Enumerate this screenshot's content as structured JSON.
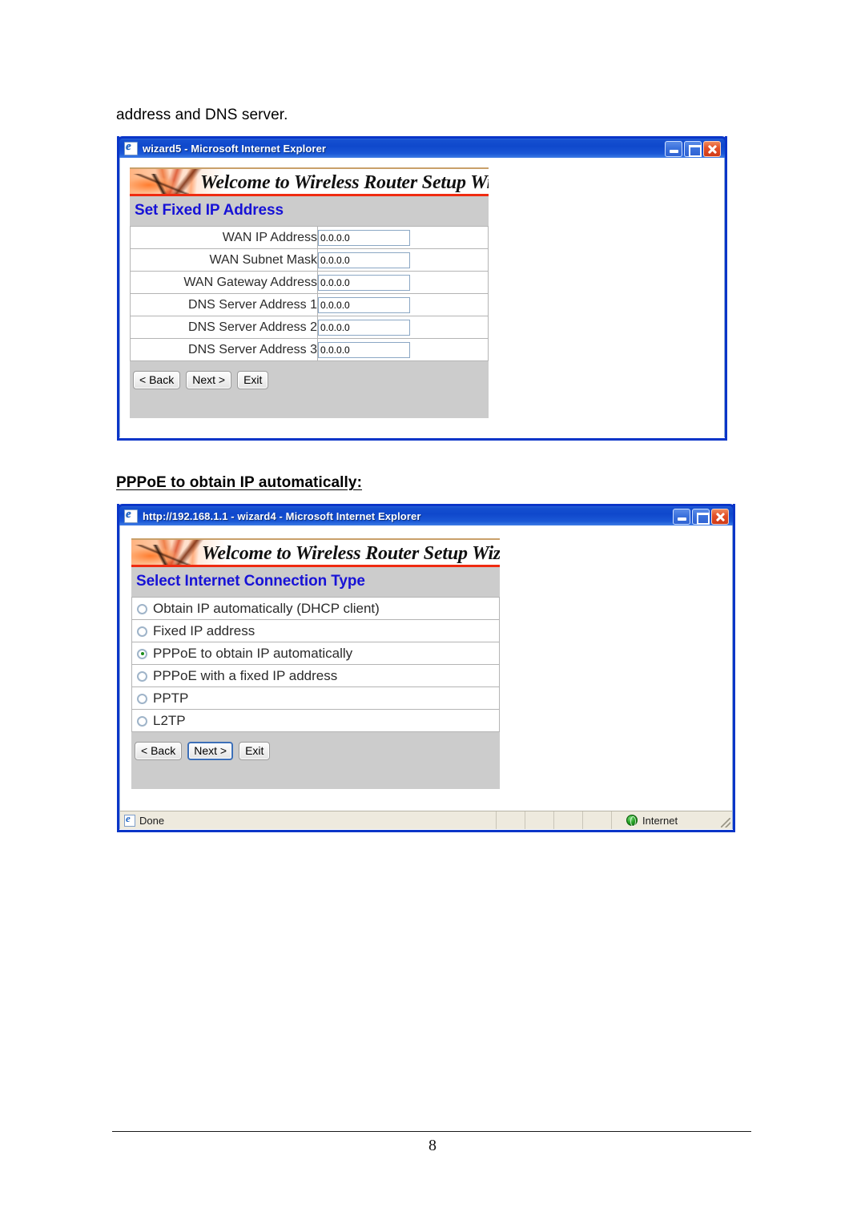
{
  "document": {
    "intro_text": "address and DNS server.",
    "section_heading": "PPPoE to obtain IP automatically:",
    "page_number": "8"
  },
  "window_fixed_ip": {
    "title": "wizard5 - Microsoft Internet Explorer",
    "doc_icon": "ie-document-icon",
    "controls": {
      "minimize": "minimize-icon",
      "maximize": "maximize-icon",
      "close": "close-icon"
    },
    "banner_title": "Welcome to Wireless Router Setup Wizard",
    "panel_heading": "Set Fixed IP Address",
    "fields": [
      {
        "label": "WAN IP Address",
        "value": "0.0.0.0"
      },
      {
        "label": "WAN Subnet Mask",
        "value": "0.0.0.0"
      },
      {
        "label": "WAN Gateway Address",
        "value": "0.0.0.0"
      },
      {
        "label": "DNS Server Address 1",
        "value": "0.0.0.0"
      },
      {
        "label": "DNS Server Address 2",
        "value": "0.0.0.0"
      },
      {
        "label": "DNS Server Address 3",
        "value": "0.0.0.0"
      }
    ],
    "buttons": {
      "back": "< Back",
      "next": "Next >",
      "exit": "Exit"
    }
  },
  "window_connection_type": {
    "title": "http://192.168.1.1 - wizard4 - Microsoft Internet Explorer",
    "doc_icon": "ie-document-icon",
    "controls": {
      "minimize": "minimize-icon",
      "maximize": "maximize-icon",
      "close": "close-icon"
    },
    "banner_title": "Welcome to Wireless Router Setup Wizard",
    "panel_heading": "Select Internet Connection Type",
    "options": [
      {
        "label": "Obtain IP automatically (DHCP client)",
        "selected": false
      },
      {
        "label": "Fixed IP address",
        "selected": false
      },
      {
        "label": "PPPoE to obtain IP automatically",
        "selected": true
      },
      {
        "label": "PPPoE with a fixed IP address",
        "selected": false
      },
      {
        "label": "PPTP",
        "selected": false
      },
      {
        "label": "L2TP",
        "selected": false
      }
    ],
    "buttons": {
      "back": "< Back",
      "next": "Next >",
      "exit": "Exit"
    },
    "statusbar": {
      "status_text": "Done",
      "zone_text": "Internet",
      "status_icon": "ie-document-icon",
      "zone_icon": "globe-icon"
    }
  },
  "colors": {
    "title_bar_blue": "#0f48cc",
    "window_border_blue": "#0a35c8",
    "panel_heading_blue": "#1712d6",
    "banner_rule_red": "#ef2b10",
    "panel_gray": "#cccccc",
    "statusbar_bg": "#eeeade",
    "radio_selected_green": "#1a8c1a"
  }
}
